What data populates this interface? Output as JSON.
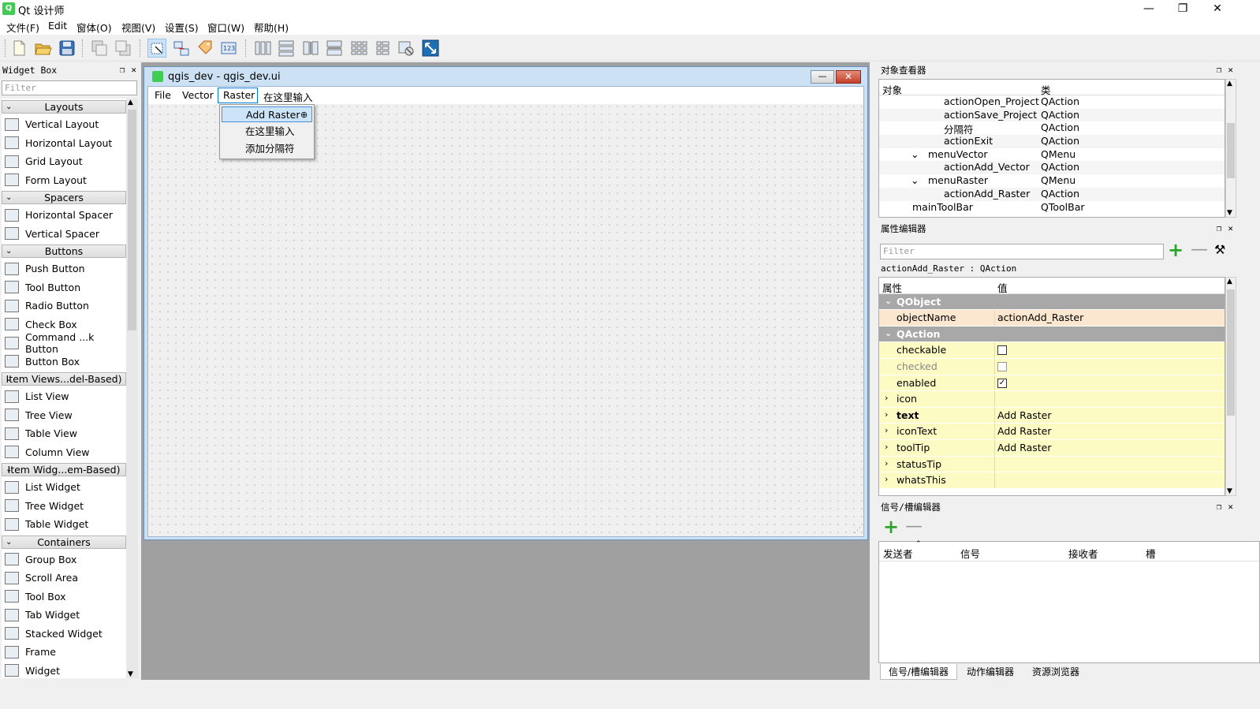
{
  "app": {
    "title": "Qt 设计师"
  },
  "window_controls": {
    "minimize": "—",
    "maximize": "❐",
    "close": "✕"
  },
  "menubar": [
    "文件(F)",
    "Edit",
    "窗体(O)",
    "视图(V)",
    "设置(S)",
    "窗口(W)",
    "帮助(H)"
  ],
  "widget_box": {
    "title": "Widget Box",
    "filter_placeholder": "Filter",
    "sections": [
      {
        "name": "Layouts",
        "items": [
          "Vertical Layout",
          "Horizontal Layout",
          "Grid Layout",
          "Form Layout"
        ]
      },
      {
        "name": "Spacers",
        "items": [
          "Horizontal Spacer",
          "Vertical Spacer"
        ]
      },
      {
        "name": "Buttons",
        "items": [
          "Push Button",
          "Tool Button",
          "Radio Button",
          "Check Box",
          "Command ...k Button",
          "Button Box"
        ]
      },
      {
        "name": "Item Views...del-Based)",
        "items": [
          "List View",
          "Tree View",
          "Table View",
          "Column View"
        ]
      },
      {
        "name": "Item Widg...em-Based)",
        "items": [
          "List Widget",
          "Tree Widget",
          "Table Widget"
        ]
      },
      {
        "name": "Containers",
        "items": [
          "Group Box",
          "Scroll Area",
          "Tool Box",
          "Tab Widget",
          "Stacked Widget",
          "Frame",
          "Widget"
        ]
      }
    ]
  },
  "form": {
    "title": "qgis_dev - qgis_dev.ui",
    "menus": [
      "File",
      "Vector",
      "Raster",
      "在这里输入"
    ],
    "raster_menu": [
      "Add Raster",
      "在这里输入",
      "添加分隔符"
    ]
  },
  "object_inspector": {
    "title": "对象查看器",
    "col_object": "对象",
    "col_class": "类",
    "rows": [
      {
        "name": "actionOpen_Project",
        "cls": "QAction",
        "indent": 3,
        "expander": ""
      },
      {
        "name": "actionSave_Project",
        "cls": "QAction",
        "indent": 3,
        "expander": ""
      },
      {
        "name": "分隔符",
        "cls": "QAction",
        "indent": 3,
        "expander": ""
      },
      {
        "name": "actionExit",
        "cls": "QAction",
        "indent": 3,
        "expander": ""
      },
      {
        "name": "menuVector",
        "cls": "QMenu",
        "indent": 2,
        "expander": "⌄"
      },
      {
        "name": "actionAdd_Vector",
        "cls": "QAction",
        "indent": 3,
        "expander": ""
      },
      {
        "name": "menuRaster",
        "cls": "QMenu",
        "indent": 2,
        "expander": "⌄"
      },
      {
        "name": "actionAdd_Raster",
        "cls": "QAction",
        "indent": 3,
        "expander": ""
      },
      {
        "name": "mainToolBar",
        "cls": "QToolBar",
        "indent": 1,
        "expander": ""
      }
    ]
  },
  "property_editor": {
    "title": "属性编辑器",
    "filter_placeholder": "Filter",
    "object_label": "actionAdd_Raster : QAction",
    "col_property": "属性",
    "col_value": "值",
    "rows": [
      {
        "kind": "group",
        "key": "QObject",
        "exp": "⌄"
      },
      {
        "kind": "obj",
        "key": "objectName",
        "value": "actionAdd_Raster"
      },
      {
        "kind": "group",
        "key": "QAction",
        "exp": "⌄"
      },
      {
        "kind": "check",
        "key": "checkable",
        "checked": ""
      },
      {
        "kind": "check-dim",
        "key": "checked",
        "checked": ""
      },
      {
        "kind": "check",
        "key": "enabled",
        "checked": "✓"
      },
      {
        "kind": "exp",
        "key": "icon",
        "value": ""
      },
      {
        "kind": "exp-bold",
        "key": "text",
        "value": "Add Raster"
      },
      {
        "kind": "exp",
        "key": "iconText",
        "value": "Add Raster"
      },
      {
        "kind": "exp",
        "key": "toolTip",
        "value": "Add Raster"
      },
      {
        "kind": "exp",
        "key": "statusTip",
        "value": ""
      },
      {
        "kind": "exp",
        "key": "whatsThis",
        "value": ""
      }
    ]
  },
  "signal_slot": {
    "title": "信号/槽编辑器",
    "columns": [
      "发送者",
      "信号",
      "接收者",
      "槽"
    ],
    "tabs": [
      "信号/槽编辑器",
      "动作编辑器",
      "资源浏览器"
    ]
  },
  "colors": {
    "accent": "#0078d7",
    "group_header": "#a8a8a8",
    "obj_row": "#fbe6cf",
    "action_row": "#fdfbc4",
    "plus": "#2da52d"
  }
}
